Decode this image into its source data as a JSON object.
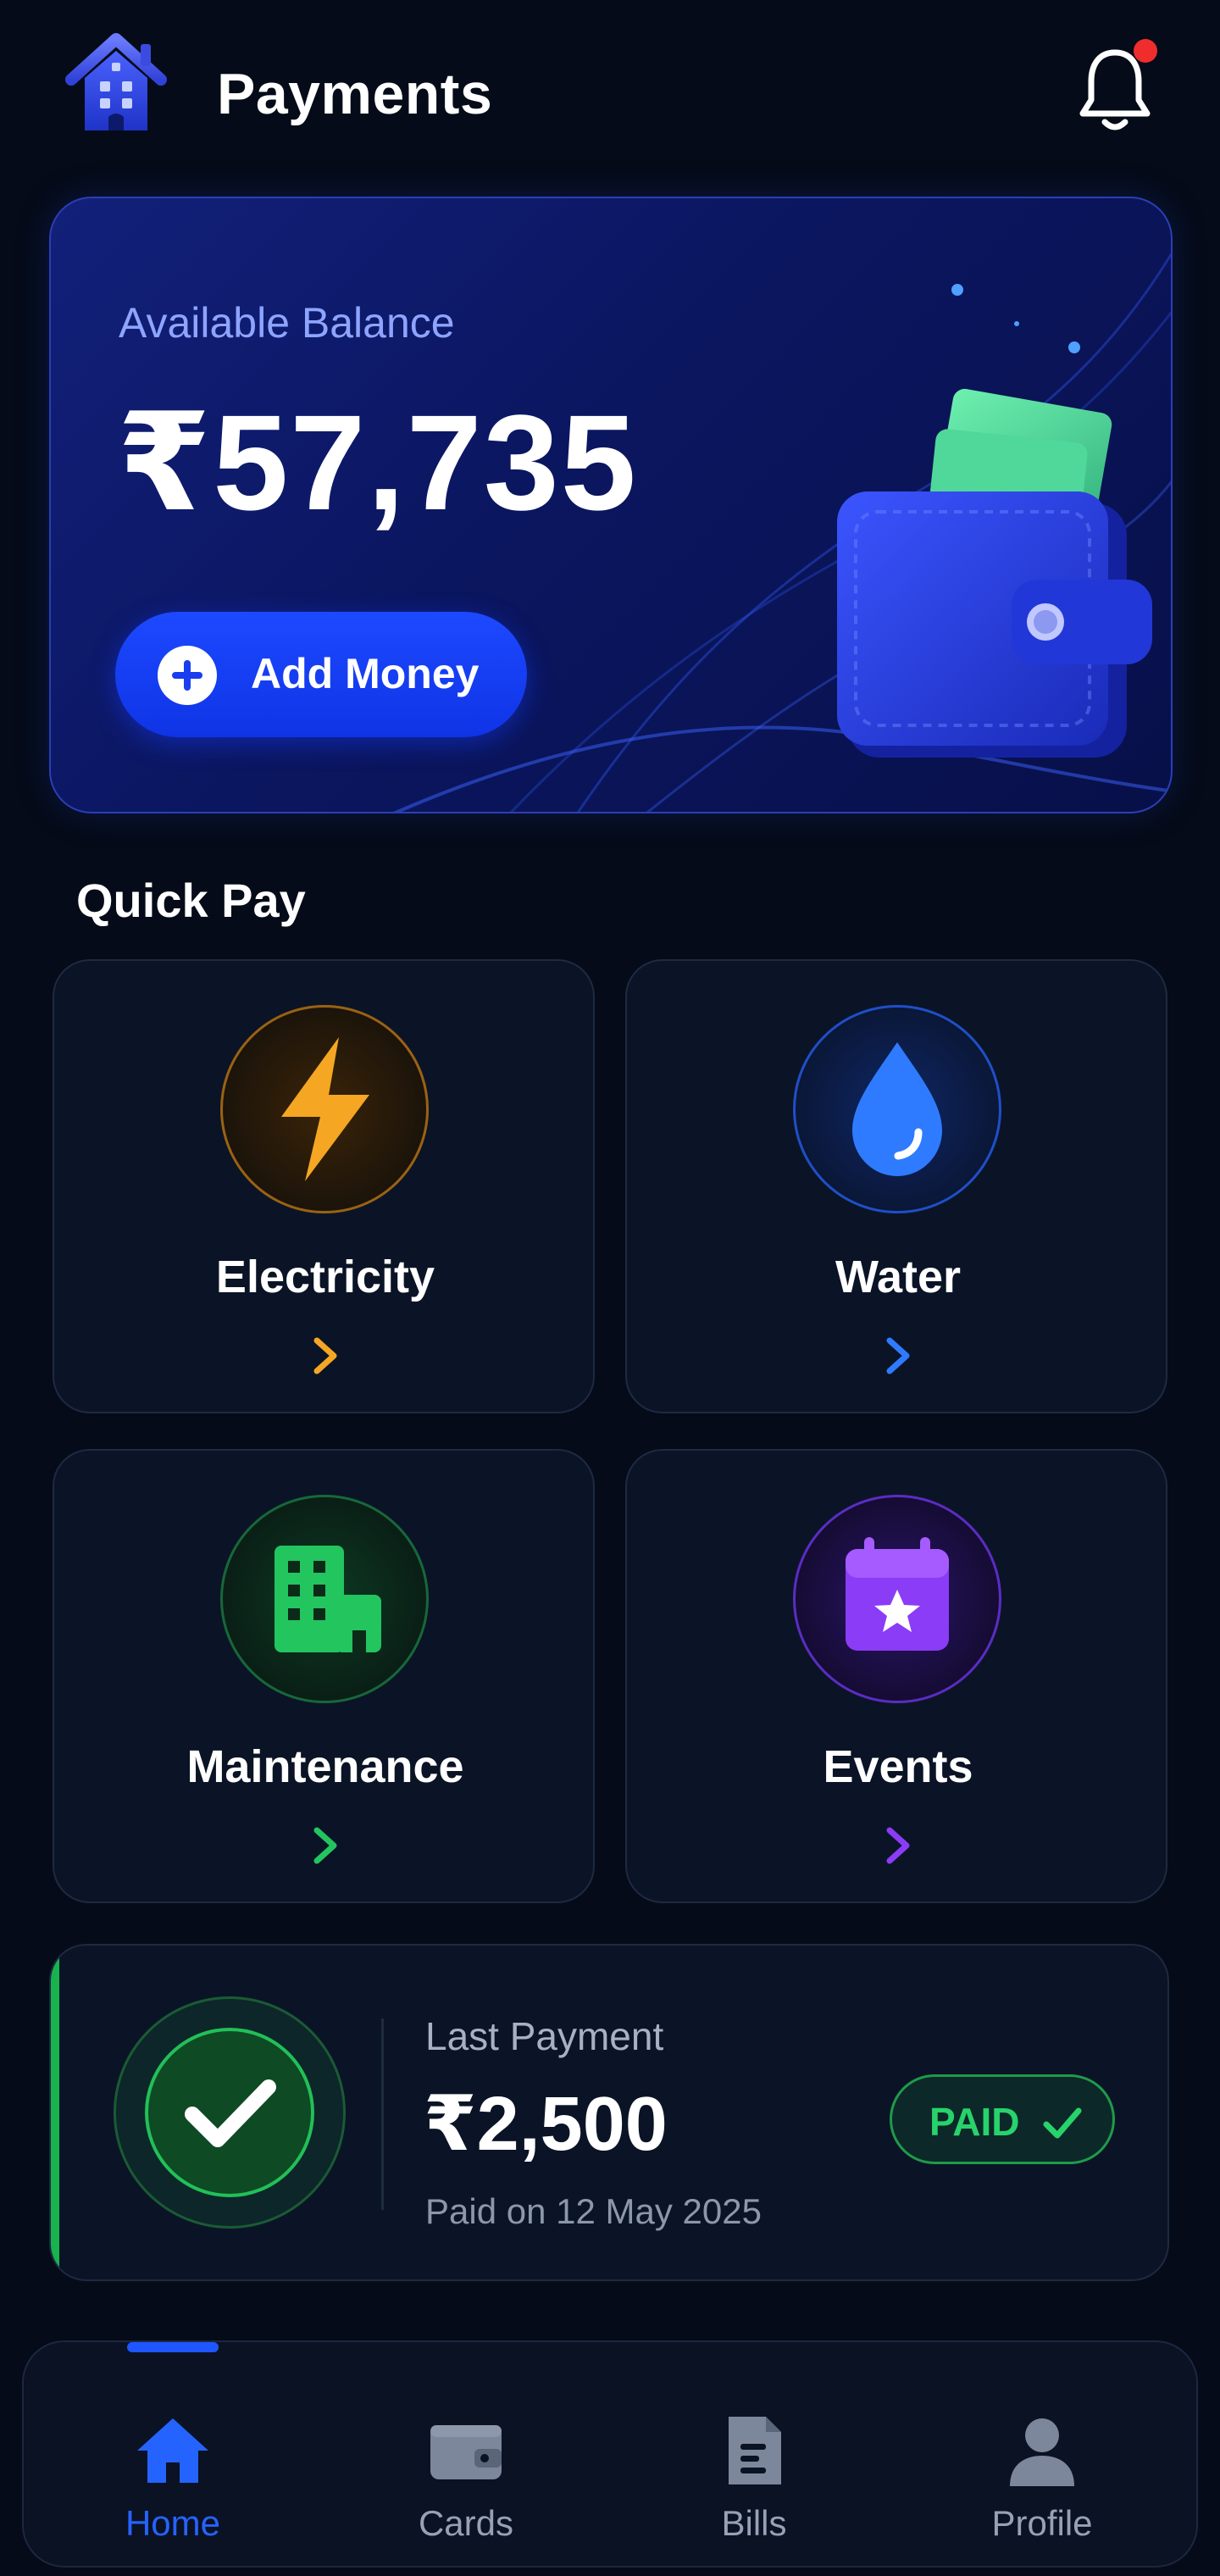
{
  "header": {
    "title": "Payments",
    "logo_icon": "home-icon",
    "notification_icon": "bell-icon"
  },
  "balance": {
    "label": "Available Balance",
    "amount": "₹57,735",
    "add_money_label": "Add Money",
    "illustration": "wallet-icon"
  },
  "quick_pay": {
    "title": "Quick Pay",
    "tiles": [
      {
        "label": "Electricity",
        "icon": "lightning-icon",
        "color": "#f5a623"
      },
      {
        "label": "Water",
        "icon": "water-drop-icon",
        "color": "#2f7bff"
      },
      {
        "label": "Maintenance",
        "icon": "building-icon",
        "color": "#22c55e"
      },
      {
        "label": "Events",
        "icon": "calendar-star-icon",
        "color": "#8b3cf7"
      }
    ]
  },
  "last_payment": {
    "label": "Last Payment",
    "amount": "₹2,500",
    "date": "Paid on 12 May 2025",
    "status": "PAID",
    "status_color": "#27d36b"
  },
  "nav": {
    "items": [
      {
        "label": "Home",
        "icon": "home-icon",
        "active": true
      },
      {
        "label": "Cards",
        "icon": "wallet-icon",
        "active": false
      },
      {
        "label": "Bills",
        "icon": "document-icon",
        "active": false
      },
      {
        "label": "Profile",
        "icon": "user-icon",
        "active": false
      }
    ],
    "active_color": "#2563ff"
  },
  "colors": {
    "background": "#050b18",
    "accent": "#1d49ff"
  }
}
